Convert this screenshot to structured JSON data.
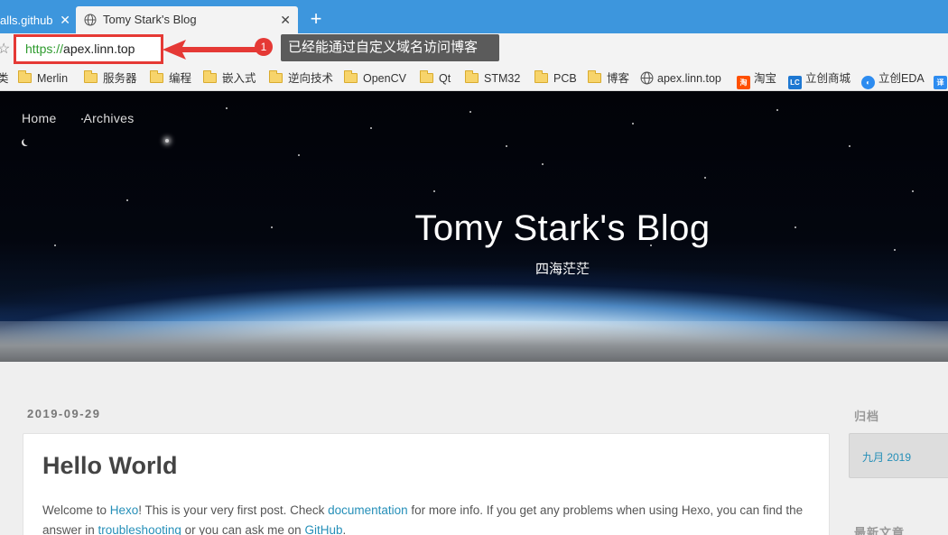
{
  "browser": {
    "prev_tab_label": "alls.github",
    "active_tab_title": "Tomy Stark's Blog",
    "close_glyph": "✕",
    "new_tab_glyph": "+",
    "url_protocol": "https://",
    "url_host": "apex.linn.top",
    "annotation_number": "1",
    "annotation_text": "已经能通过自定义域名访问博客",
    "accent_color": "#3d96dd",
    "highlight_color": "#e53935"
  },
  "bookmarks": {
    "edge_label": "类",
    "items": [
      {
        "label": "Merlin",
        "icon": "folder-icon"
      },
      {
        "label": "服务器",
        "icon": "folder-icon"
      },
      {
        "label": "编程",
        "icon": "folder-icon"
      },
      {
        "label": "嵌入式",
        "icon": "folder-icon"
      },
      {
        "label": "逆向技术",
        "icon": "folder-icon"
      },
      {
        "label": "OpenCV",
        "icon": "folder-icon"
      },
      {
        "label": "Qt",
        "icon": "folder-icon"
      },
      {
        "label": "STM32",
        "icon": "folder-icon"
      },
      {
        "label": "PCB",
        "icon": "folder-icon"
      },
      {
        "label": "博客",
        "icon": "folder-icon"
      },
      {
        "label": "apex.linn.top",
        "icon": "globe-icon"
      },
      {
        "label": "淘宝",
        "icon": "taobao-icon"
      },
      {
        "label": "立创商城",
        "icon": "lc-icon"
      },
      {
        "label": "立创EDA",
        "icon": "lceda-icon"
      },
      {
        "label": "",
        "icon": "translate-icon"
      }
    ]
  },
  "blog": {
    "nav": [
      "Home",
      "Archives"
    ],
    "title": "Tomy Stark's Blog",
    "subtitle": "四海茫茫",
    "post": {
      "date": "2019-09-29",
      "title": "Hello World",
      "body_parts": {
        "p1": "Welcome to ",
        "link1": "Hexo",
        "p2": "! This is your very first post. Check ",
        "link2": "documentation",
        "p3": " for more info. If you get any problems when using Hexo, you can find the answer in ",
        "link3": "troubleshooting",
        "p4": " or you can ask me on ",
        "link4": "GitHub",
        "p5": "."
      }
    },
    "sidebar": {
      "archive_heading": "归档",
      "archive_item": "九月 2019",
      "recent_heading": "最新文章"
    }
  }
}
